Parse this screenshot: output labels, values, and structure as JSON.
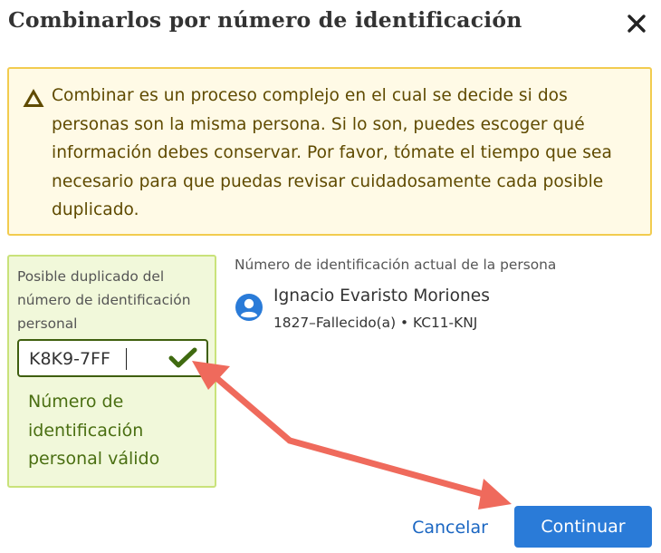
{
  "dialog": {
    "title": "Combinarlos por número de identificación",
    "close_icon": "close-icon"
  },
  "warning": {
    "icon": "warning-icon",
    "text": "Combinar es un proceso complejo en el cual se decide si dos personas son la misma persona. Si lo son, puedes escoger qué información debes conservar. Por favor, tómate el tiempo que sea necesario para que puedas revisar cuidadosamente cada posible duplicado.",
    "color_text": "#5f4a00",
    "color_bg": "#fffae6",
    "color_border": "#f2cc4f"
  },
  "duplicate": {
    "label": "Posible duplicado del número de identificación personal",
    "value": "K8K9-7FF",
    "check_icon": "checkmark-icon",
    "valid_message": "Número de identificación personal válido",
    "color_accent": "#4a6f12"
  },
  "current": {
    "label": "Número de identificación actual de la persona",
    "avatar_icon": "person-icon",
    "name": "Ignacio Evaristo Moriones",
    "details": "1827–Fallecido(a) • KC11-KNJ"
  },
  "actions": {
    "cancel_label": "Cancelar",
    "continue_label": "Continuar",
    "color_primary": "#2a7bd8"
  },
  "annotation": {
    "arrow_icon": "double-headed-arrow-icon",
    "color": "#ef6a5c"
  }
}
